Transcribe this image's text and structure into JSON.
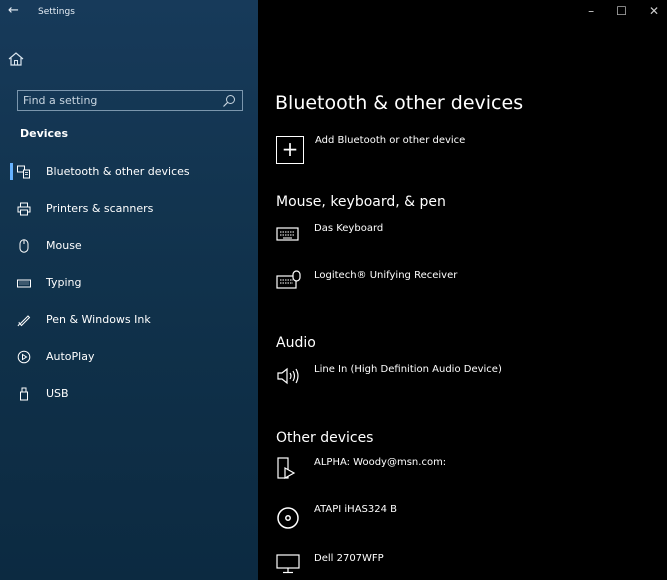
{
  "window": {
    "back_glyph": "←",
    "title": "Settings",
    "controls": [
      "–",
      "☐",
      "✕"
    ]
  },
  "sidebar": {
    "search_placeholder": "Find a setting",
    "section_title": "Devices",
    "items": [
      {
        "label": "Bluetooth & other devices",
        "icon": "bluetooth-device-icon",
        "selected": true
      },
      {
        "label": "Printers & scanners",
        "icon": "printer-icon"
      },
      {
        "label": "Mouse",
        "icon": "mouse-icon"
      },
      {
        "label": "Typing",
        "icon": "keyboard-icon"
      },
      {
        "label": "Pen & Windows Ink",
        "icon": "pen-icon"
      },
      {
        "label": "AutoPlay",
        "icon": "autoplay-icon"
      },
      {
        "label": "USB",
        "icon": "usb-icon"
      }
    ]
  },
  "main": {
    "title": "Bluetooth & other devices",
    "add_label": "Add Bluetooth or other device",
    "sections": {
      "mouse": {
        "title": "Mouse, keyboard, & pen",
        "devices": [
          {
            "label": "Das Keyboard",
            "icon": "keyboard-icon"
          },
          {
            "label": "Logitech® Unifying Receiver",
            "icon": "keyboard-mouse-icon"
          }
        ]
      },
      "audio": {
        "title": "Audio",
        "devices": [
          {
            "label": "Line In (High Definition Audio Device)",
            "icon": "speaker-icon"
          }
        ]
      },
      "other": {
        "title": "Other devices",
        "devices": [
          {
            "label": "ALPHA: Woody@msn.com:",
            "icon": "media-device-icon"
          },
          {
            "label": "ATAPI iHAS324   B",
            "icon": "disc-drive-icon"
          },
          {
            "label": "Dell 2707WFP",
            "icon": "monitor-icon"
          }
        ]
      }
    }
  },
  "colors": {
    "accent": "#66b2ff",
    "sidebar_top": "#173a5a",
    "background": "#000000"
  }
}
